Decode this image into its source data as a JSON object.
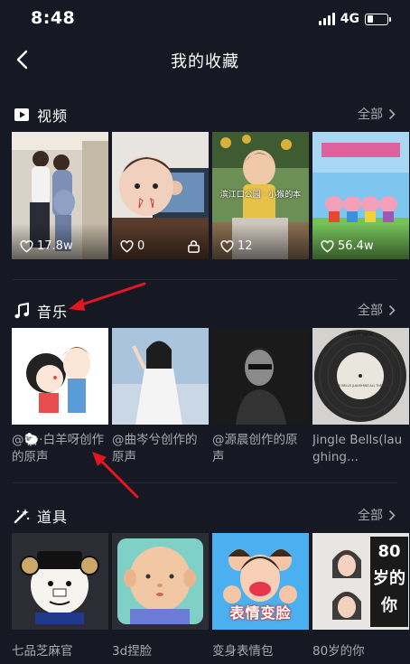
{
  "status_bar": {
    "time": "8:48",
    "network": "4G"
  },
  "nav": {
    "title": "我的收藏"
  },
  "videos": {
    "title": "视频",
    "see_all": "全部",
    "items": [
      {
        "likes": "17.8w",
        "locked": false
      },
      {
        "likes": "0",
        "locked": true
      },
      {
        "likes": "12",
        "locked": false,
        "overlay_text": "滨江口公园 · 小猴的本"
      },
      {
        "likes": "56.4w",
        "locked": false
      }
    ]
  },
  "music": {
    "title": "音乐",
    "see_all": "全部",
    "items": [
      {
        "caption": "@🐑·白羊呀创作的原声"
      },
      {
        "caption": "@曲岑兮创作的原声"
      },
      {
        "caption": "@源晨创作的原声"
      },
      {
        "caption": "Jingle Bells(laughing...",
        "label_text": "SAINT NICK",
        "label_sub": "JINGLE BELLS (LAUGHING ALL THE WAY)"
      }
    ]
  },
  "props": {
    "title": "道具",
    "see_all": "全部",
    "items": [
      {
        "name": "七品芝麻官"
      },
      {
        "name": "3d捏脸"
      },
      {
        "name": "变身表情包",
        "overlay_text": "表情变脸"
      },
      {
        "name": "80岁的你",
        "overlay_text": "80岁的你"
      }
    ]
  },
  "colors": {
    "background": "#161823",
    "secondary_text": "#a9aab0",
    "annotation_arrow": "#e3161e"
  }
}
